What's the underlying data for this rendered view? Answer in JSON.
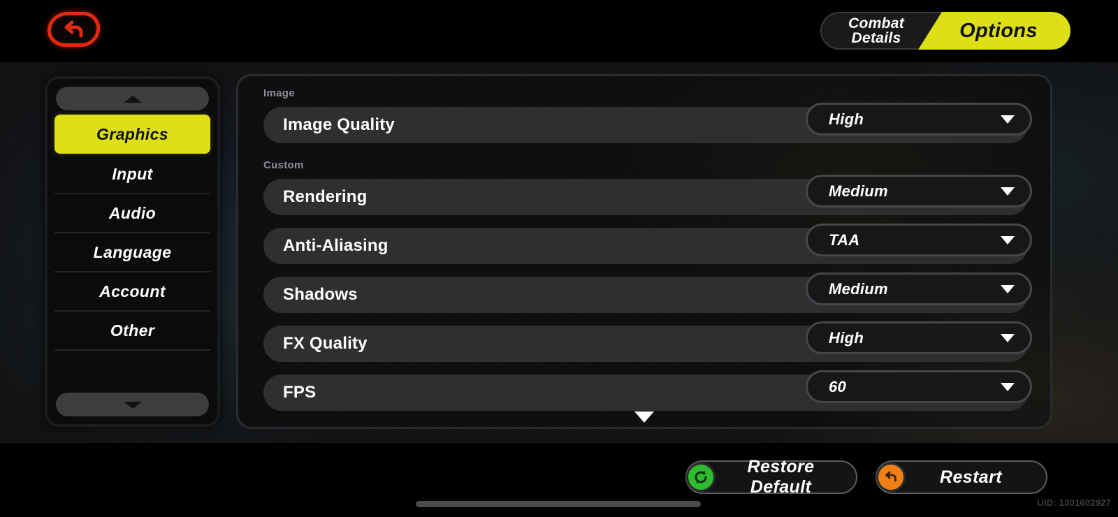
{
  "header": {
    "back_icon": "back-arrow-icon",
    "tabs": [
      {
        "label": "Combat\nDetails",
        "active": false
      },
      {
        "label": "Options",
        "active": true
      }
    ]
  },
  "sidebar": {
    "scroll_up_icon": "chevron-up-icon",
    "scroll_down_icon": "chevron-down-icon",
    "items": [
      {
        "label": "Graphics",
        "selected": true
      },
      {
        "label": "Input",
        "selected": false
      },
      {
        "label": "Audio",
        "selected": false
      },
      {
        "label": "Language",
        "selected": false
      },
      {
        "label": "Account",
        "selected": false
      },
      {
        "label": "Other",
        "selected": false
      }
    ]
  },
  "panel": {
    "sections": [
      {
        "label": "Image"
      },
      {
        "label": "Custom"
      }
    ],
    "rows": [
      {
        "label": "Image Quality",
        "value": "High"
      },
      {
        "label": "Rendering",
        "value": "Medium"
      },
      {
        "label": "Anti-Aliasing",
        "value": "TAA"
      },
      {
        "label": "Shadows",
        "value": "Medium"
      },
      {
        "label": "FX Quality",
        "value": "High"
      },
      {
        "label": "FPS",
        "value": "60"
      }
    ],
    "scroll_down_icon": "triangle-down-icon"
  },
  "footer": {
    "restore_label": "Restore Default",
    "restore_icon": "refresh-circle-icon",
    "restart_label": "Restart",
    "restart_icon": "restart-circle-icon",
    "uid": "UID: 1301602927"
  },
  "colors": {
    "accent_yellow": "#dde017",
    "back_red": "#e02a12",
    "restore_green": "#2ebb2e",
    "restart_orange": "#f07f16"
  }
}
